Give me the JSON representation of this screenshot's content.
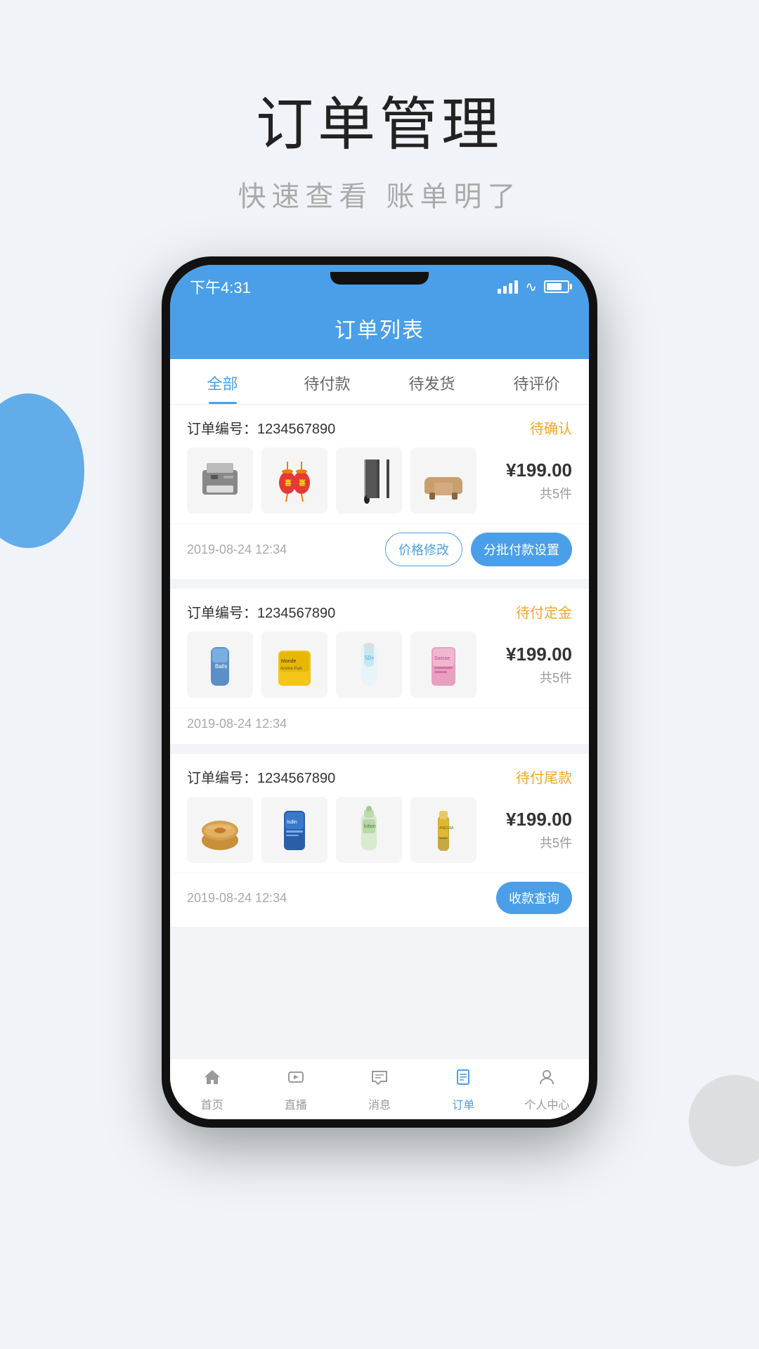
{
  "page": {
    "title": "订单管理",
    "subtitle": "快速查看 账单明了",
    "bg_color": "#f0f4f8"
  },
  "status_bar": {
    "time": "下午4:31"
  },
  "app_header": {
    "title": "订单列表"
  },
  "tabs": [
    {
      "label": "全部",
      "active": true
    },
    {
      "label": "待付款",
      "active": false
    },
    {
      "label": "待发货",
      "active": false
    },
    {
      "label": "待评价",
      "active": false
    }
  ],
  "orders": [
    {
      "id": "order-1",
      "number_label": "订单编号：",
      "number": "1234567890",
      "status": "待确认",
      "status_class": "status-pending",
      "price": "¥199.00",
      "count": "共5件",
      "date": "2019-08-24 12:34",
      "has_buttons": true,
      "buttons": [
        {
          "label": "价格修改",
          "type": "outline"
        },
        {
          "label": "分批付款设置",
          "type": "solid"
        }
      ]
    },
    {
      "id": "order-2",
      "number_label": "订单编号：",
      "number": "1234567890",
      "status": "待付定金",
      "status_class": "status-deposit",
      "price": "¥199.00",
      "count": "共5件",
      "date": "2019-08-24 12:34",
      "has_buttons": false,
      "buttons": []
    },
    {
      "id": "order-3",
      "number_label": "订单编号：",
      "number": "1234567890",
      "status": "待付尾款",
      "status_class": "status-balance",
      "price": "¥199.00",
      "count": "共5件",
      "date": "2019-08-24 12:34",
      "has_buttons": true,
      "buttons": [
        {
          "label": "收款查询",
          "type": "solid"
        }
      ]
    }
  ],
  "bottom_nav": [
    {
      "label": "首页",
      "icon": "home",
      "active": false
    },
    {
      "label": "直播",
      "icon": "live",
      "active": false
    },
    {
      "label": "消息",
      "icon": "message",
      "active": false
    },
    {
      "label": "订单",
      "icon": "order",
      "active": true
    },
    {
      "label": "个人中心",
      "icon": "user",
      "active": false
    }
  ]
}
